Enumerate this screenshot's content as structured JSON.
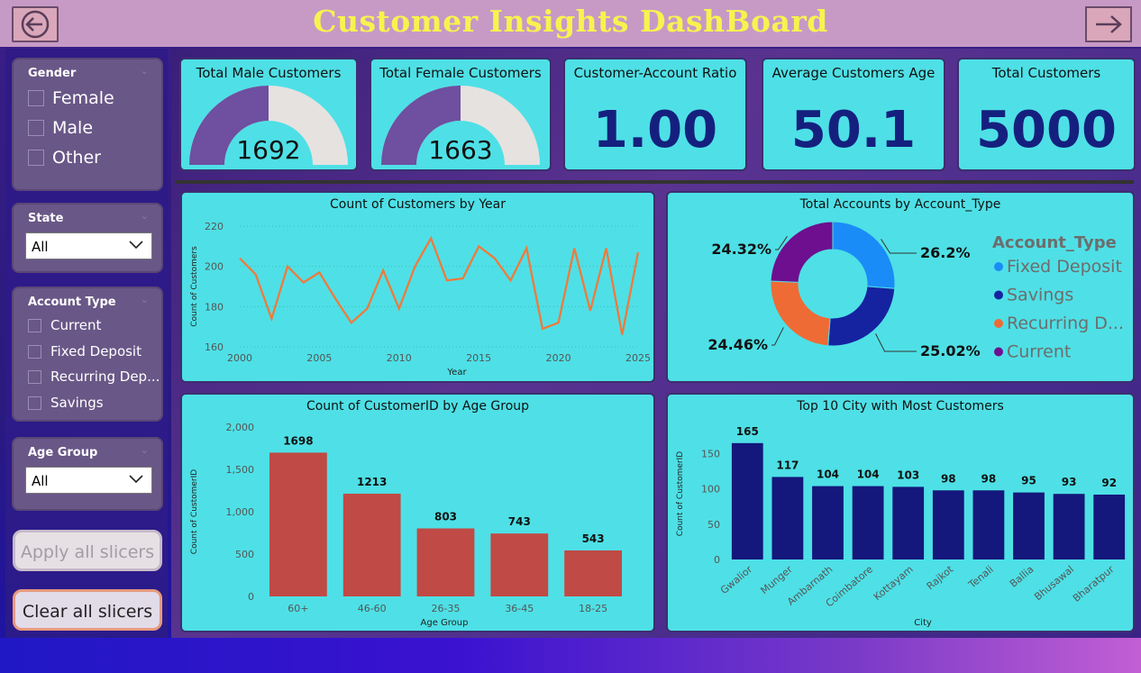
{
  "header": {
    "title": "Customer Insights DashBoard"
  },
  "slicers": {
    "gender": {
      "title": "Gender",
      "options": [
        "Female",
        "Male",
        "Other"
      ]
    },
    "state": {
      "title": "State",
      "selected": "All"
    },
    "account_type": {
      "title": "Account Type",
      "options": [
        "Current",
        "Fixed Deposit",
        "Recurring Dep...",
        "Savings"
      ]
    },
    "age_group": {
      "title": "Age Group",
      "selected": "All"
    },
    "apply_label": "Apply all slicers",
    "clear_label": "Clear all slicers"
  },
  "kpis": {
    "male": {
      "title": "Total Male Customers",
      "value": "1692",
      "gauge_fraction": 0.5
    },
    "female": {
      "title": "Total Female Customers",
      "value": "1663",
      "gauge_fraction": 0.5
    },
    "ratio": {
      "title": "Customer-Account Ratio",
      "value": "1.00"
    },
    "avg_age": {
      "title": "Average Customers Age",
      "value": "50.1"
    },
    "total": {
      "title": "Total Customers",
      "value": "5000"
    }
  },
  "colors": {
    "line": "#ef7a3c",
    "age_bars": "#c04a46",
    "city_bars": "#14177b",
    "fixed_deposit": "#1a8cf7",
    "savings": "#1623a0",
    "recurring": "#ef6b35",
    "current": "#6e0f8f",
    "gauge_fill": "#6e4fa0",
    "gauge_track": "#e6e2e0"
  },
  "chart_data": [
    {
      "type": "line",
      "title": "Count of Customers by Year",
      "xlabel": "Year",
      "ylabel": "Count of Customers",
      "x": [
        2000,
        2001,
        2002,
        2003,
        2004,
        2005,
        2006,
        2007,
        2008,
        2009,
        2010,
        2011,
        2012,
        2013,
        2014,
        2015,
        2016,
        2017,
        2018,
        2019,
        2020,
        2021,
        2022,
        2023,
        2024,
        2025
      ],
      "y": [
        204,
        196,
        174,
        200,
        192,
        197,
        184,
        172,
        179,
        198,
        179,
        200,
        214,
        193,
        194,
        210,
        204,
        193,
        209,
        169,
        172,
        209,
        178,
        209,
        166,
        207
      ],
      "xticks": [
        "2000",
        "2005",
        "2010",
        "2015",
        "2020",
        "2025"
      ],
      "yticks": [
        "160",
        "180",
        "200",
        "220"
      ],
      "ylim": [
        160,
        220
      ]
    },
    {
      "type": "pie",
      "title": "Total Accounts by Account_Type",
      "legend_title": "Account_Type",
      "labels": [
        "Fixed Deposit",
        "Savings",
        "Recurring D...",
        "Current"
      ],
      "values": [
        26.2,
        25.02,
        24.46,
        24.32
      ],
      "value_labels": [
        "26.2%",
        "25.02%",
        "24.46%",
        "24.32%"
      ],
      "legend": "right"
    },
    {
      "type": "bar",
      "title": "Count of CustomerID by Age Group",
      "xlabel": "Age Group",
      "ylabel": "Count of CustomerID",
      "categories": [
        "60+",
        "46-60",
        "26-35",
        "36-45",
        "18-25"
      ],
      "values": [
        1698,
        1213,
        803,
        743,
        543
      ],
      "yticks": [
        "2,000",
        "1,500",
        "1,000",
        "500",
        "0"
      ],
      "ylim": [
        0,
        2000
      ]
    },
    {
      "type": "bar",
      "title": "Top 10 City with Most Customers",
      "xlabel": "City",
      "ylabel": "Count of CustomerID",
      "categories": [
        "Gwalior",
        "Munger",
        "Ambarnath",
        "Coimbatore",
        "Kottayam",
        "Rajkot",
        "Tenali",
        "Ballia",
        "Bhusawal",
        "Bharatpur"
      ],
      "values": [
        165,
        117,
        104,
        104,
        103,
        98,
        98,
        95,
        93,
        92
      ],
      "yticks": [
        "150",
        "100",
        "50",
        "0"
      ],
      "ylim": [
        0,
        175
      ]
    }
  ]
}
